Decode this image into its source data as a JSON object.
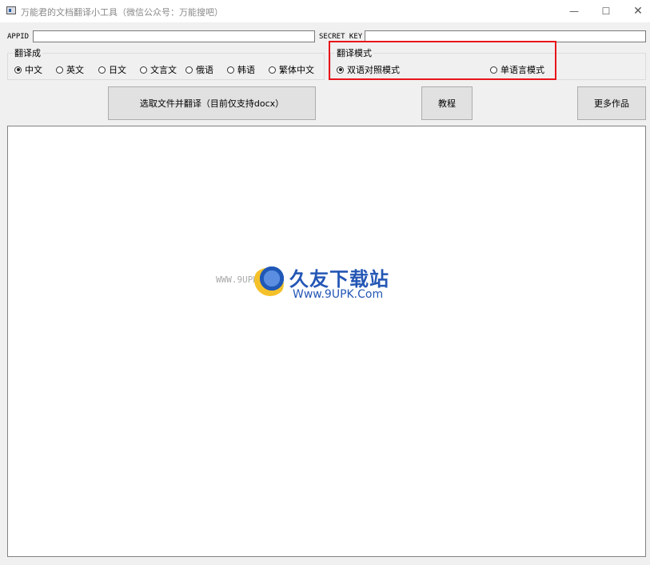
{
  "window": {
    "title": "万能君的文档翻译小工具（微信公众号：万能搜吧）",
    "minimize_icon": "—",
    "maximize_icon": "☐",
    "close_icon": "✕"
  },
  "credentials": {
    "appid_label": "APPID",
    "appid_value": "",
    "secret_label": "SECRET KEY",
    "secret_value": ""
  },
  "translate_to": {
    "title": "翻译成",
    "options": [
      "中文",
      "英文",
      "日文",
      "文言文",
      "俄语",
      "韩语",
      "繁体中文"
    ],
    "selected": "中文"
  },
  "translate_mode": {
    "title": "翻译模式",
    "options": [
      "双语对照模式",
      "单语言模式"
    ],
    "selected": "双语对照模式"
  },
  "buttons": {
    "select_file": "选取文件并翻译（目前仅支持docx）",
    "tutorial": "教程",
    "more_works": "更多作品"
  },
  "output": {
    "text": ""
  },
  "watermark": {
    "small_text": "WWW.9UPK.COM",
    "brand": "久友下载站",
    "url": "Www.9UPK.Com"
  },
  "colors": {
    "highlight": "#e8151b",
    "watermark": "#2457b5"
  }
}
